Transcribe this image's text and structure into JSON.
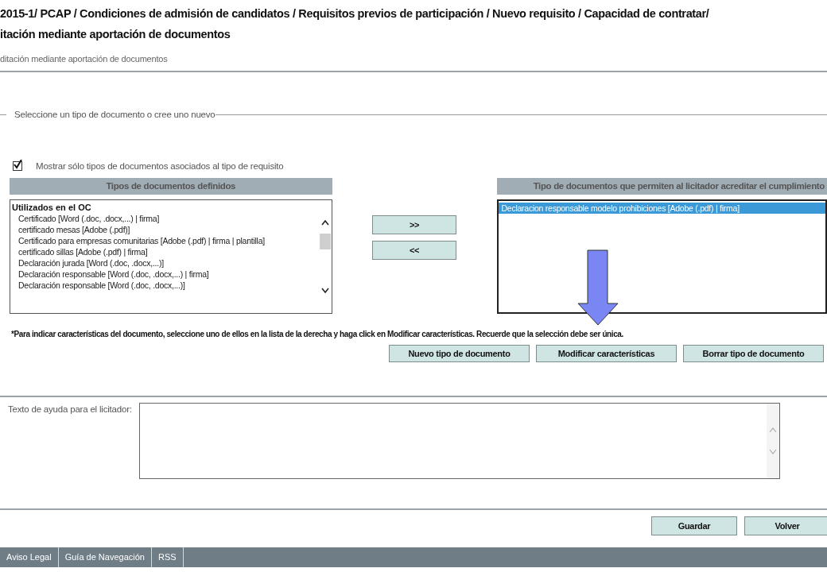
{
  "title": {
    "lines": [
      "2015-1/ PCAP / Condiciones de admisión de candidatos / Requisitos previos de participación / Nuevo requisito / Capacidad de contratar/",
      "itación mediante aportación de documentos"
    ]
  },
  "subtitle": "ditación mediante aportación de documentos",
  "fieldset": {
    "legend": "Seleccione un tipo de documento o cree uno nuevo"
  },
  "filter_checkbox": {
    "label": "Mostrar sólo tipos de documentos asociados al tipo de requisito",
    "checked": true
  },
  "available": {
    "header": "Tipos de documentos definidos",
    "groups": [
      {
        "label": "Utilizados en el OC",
        "items": [
          {
            "label": "Certificado [Word (.doc, .docx,...) | firma]",
            "selected": false
          },
          {
            "label": "certificado mesas [Adobe (.pdf)]",
            "selected": false
          },
          {
            "label": "Certificado para empresas comunitarias [Adobe (.pdf) | firma | plantilla]",
            "selected": false
          },
          {
            "label": "certificado sillas [Adobe (.pdf) | firma]",
            "selected": false
          },
          {
            "label": "Declaración jurada [Word (.doc, .docx,...)]",
            "selected": false
          },
          {
            "label": "Declaración responsable [Word (.doc, .docx,...) | firma]",
            "selected": false
          },
          {
            "label": "Declaración responsable [Word (.doc, .docx,...)]",
            "selected": false
          }
        ]
      }
    ]
  },
  "transfer_buttons": [
    ">>",
    "<<"
  ],
  "chosen": {
    "header": "Tipo de documentos que permiten al licitador acreditar el cumplimiento",
    "items": [
      {
        "label": "Declaracion responsable modelo prohibiciones [Adobe (.pdf) | firma]",
        "selected": true
      }
    ]
  },
  "note": "*Para indicar características del documento, seleccione uno de ellos en la lista de la derecha y haga click en Modificar características. Recuerde que la selección debe ser única.",
  "document_buttons": [
    "Nuevo tipo de documento",
    "Modificar características",
    "Borrar tipo de documento"
  ],
  "help_text": {
    "label": "Texto de ayuda para el licitador:"
  },
  "actions": [
    "Guardar",
    "Volver"
  ],
  "footer_links": [
    "Aviso Legal",
    "Guía de Navegación",
    "RSS"
  ]
}
